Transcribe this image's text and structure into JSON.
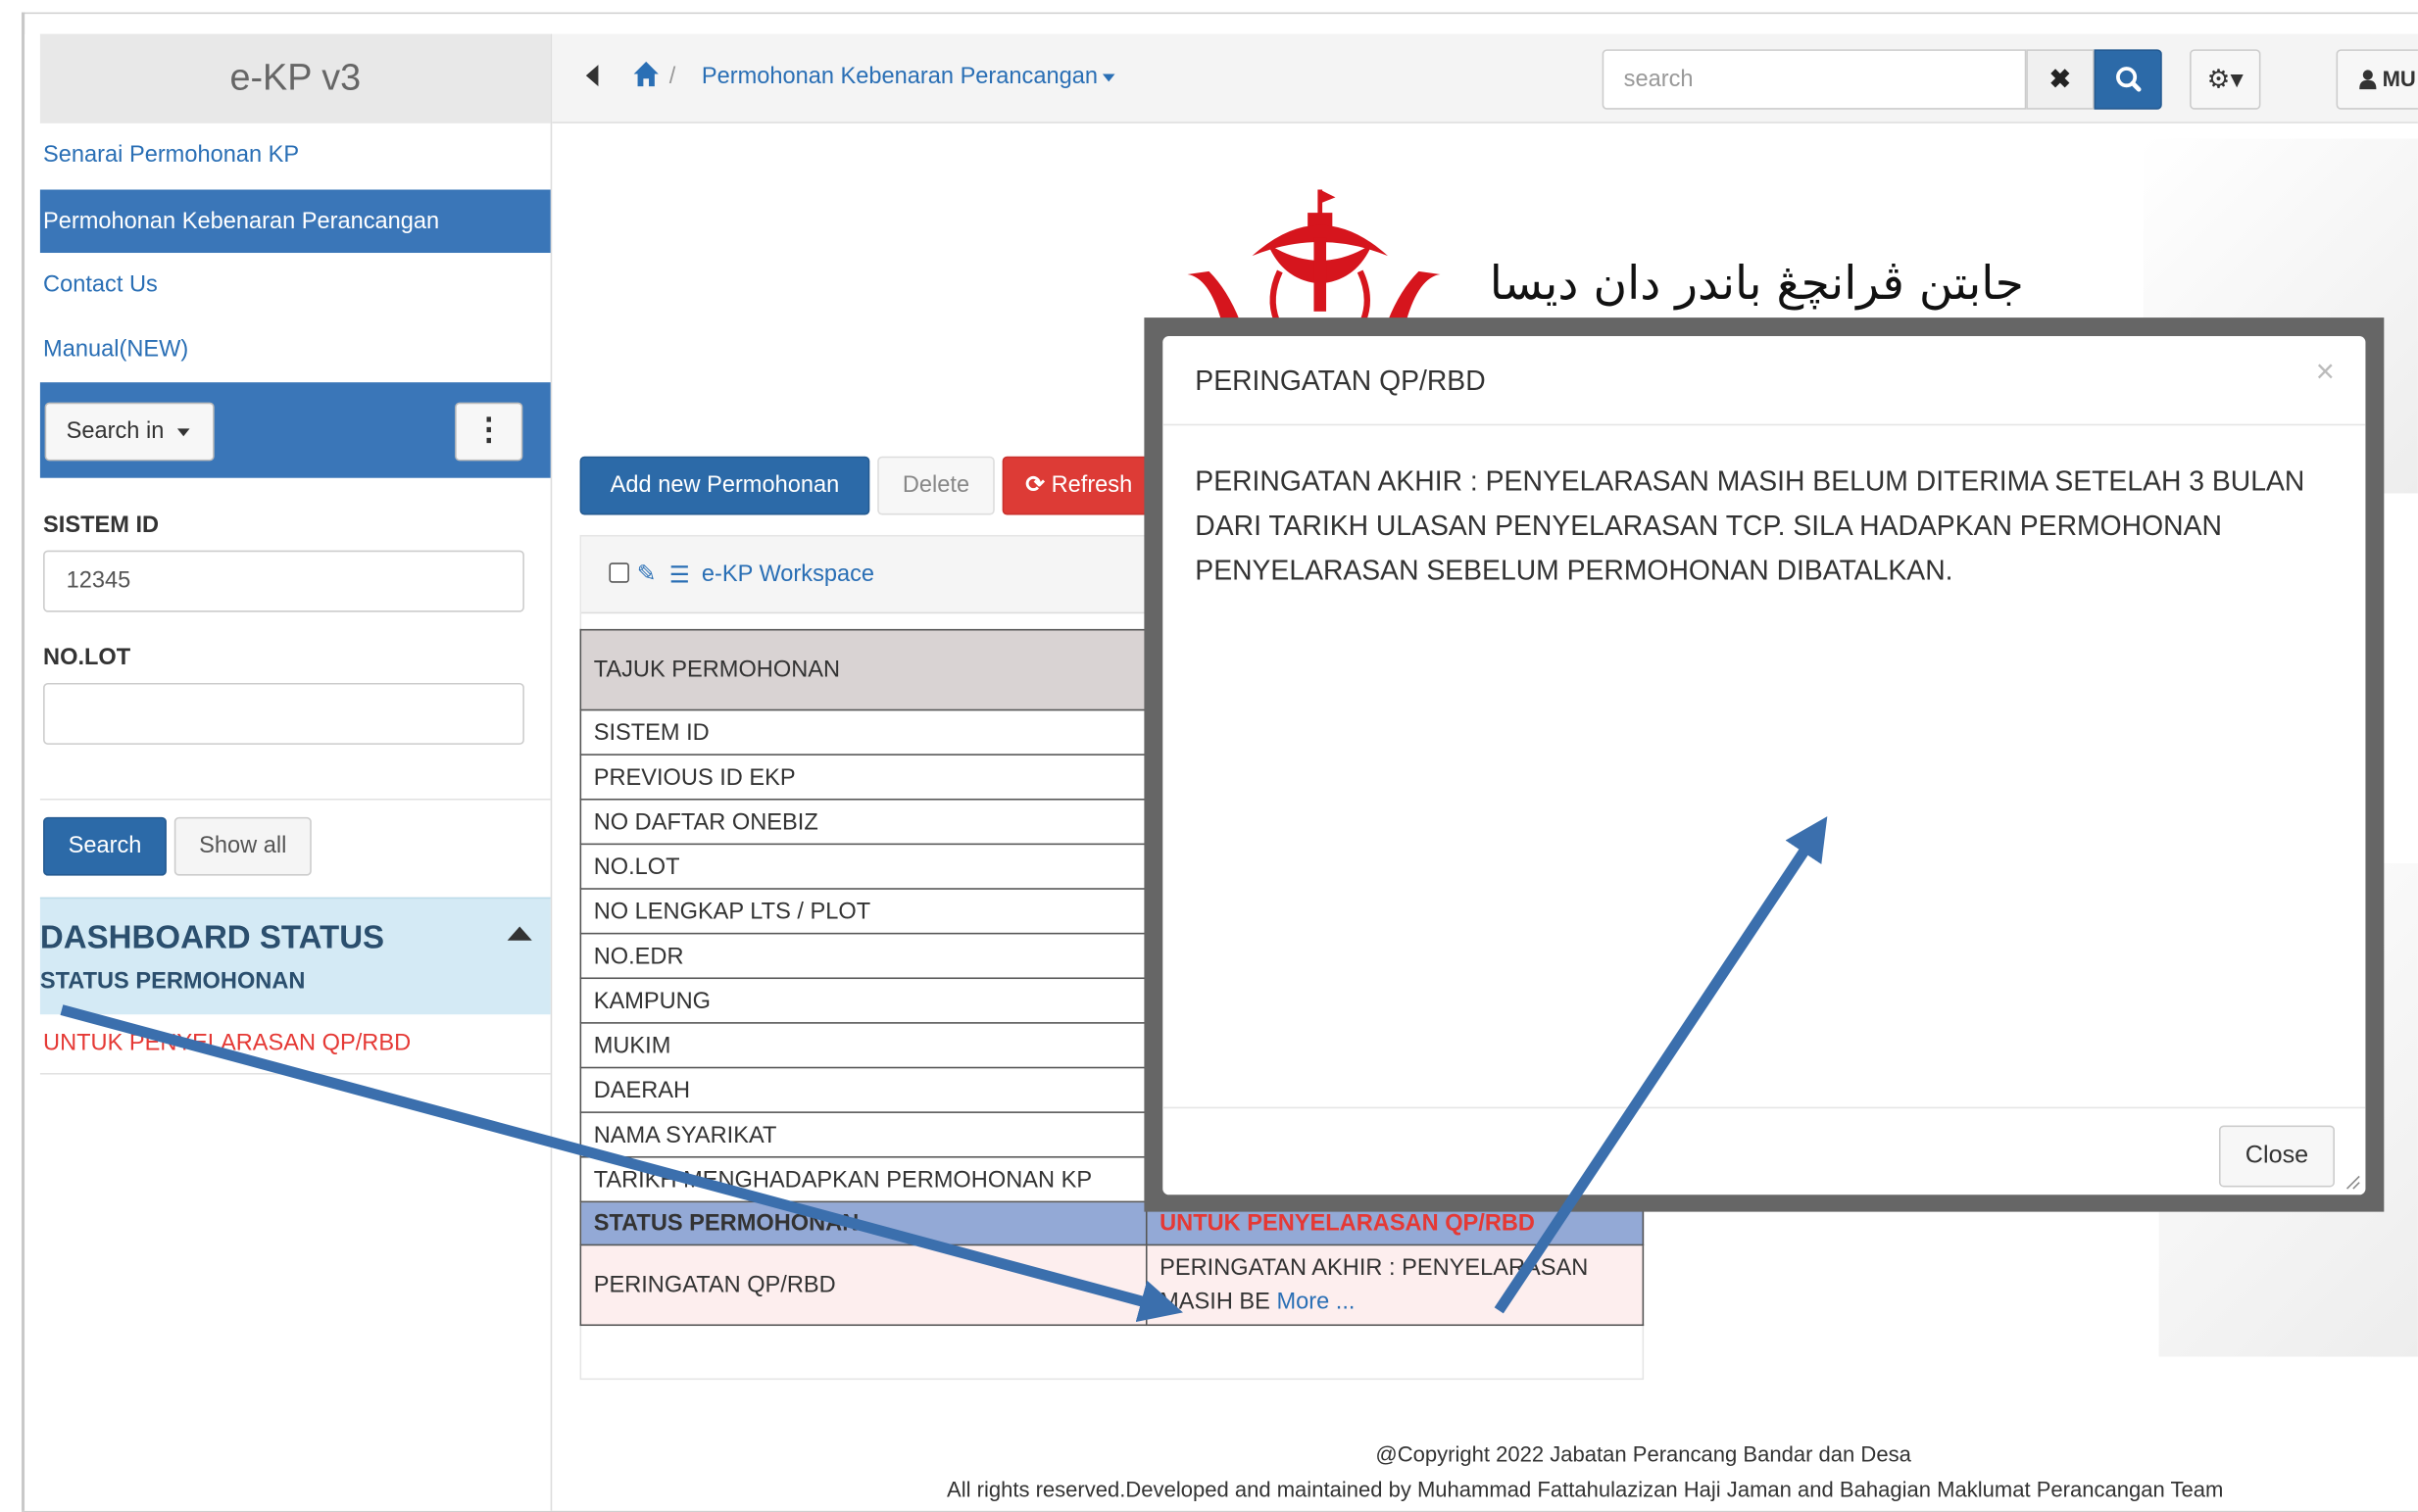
{
  "sidebar": {
    "brand": "e-KP v3",
    "links": [
      "Senarai Permohonan KP",
      "Permohonan Kebenaran Perancangan",
      "Contact Us",
      "Manual(NEW)"
    ],
    "search_in_label": "Search in",
    "kebab_label": "⋮",
    "field1_label": "SISTEM ID",
    "field1_value": "12345",
    "field2_label": "NO.LOT",
    "field2_value": "",
    "search_button": "Search",
    "show_all_button": "Show all",
    "dashboard_title": "DASHBOARD STATUS",
    "dashboard_subtitle": "STATUS PERMOHONAN",
    "dashboard_item": "UNTUK PENYELARASAN QP/RBD"
  },
  "topbar": {
    "breadcrumb_separator": "/",
    "breadcrumb_label": "Permohonan Kebenaran Perancangan",
    "search_placeholder": "search",
    "clear_label": "✖",
    "gear_label": "⚙▾",
    "user_label": "MU"
  },
  "banner": {
    "jawi_text": "جابتن ڤرانچڠ باندر دان ديسا"
  },
  "toolbar": {
    "add_label": "Add new Permohonan",
    "delete_label": "Delete",
    "refresh_label": "Refresh"
  },
  "workspace": {
    "label": "e-KP Workspace"
  },
  "table": {
    "header": "TAJUK PERMOHONAN",
    "rows": [
      "SISTEM ID",
      "PREVIOUS ID EKP",
      "NO DAFTAR ONEBIZ",
      "NO.LOT",
      "NO LENGKAP LTS / PLOT",
      "NO.EDR",
      "KAMPUNG",
      "MUKIM",
      "DAERAH",
      "NAMA SYARIKAT",
      "TARIKH MENGHADAPKAN PERMOHONAN KP"
    ],
    "status_label": "STATUS PERMOHONAN",
    "status_value": "UNTUK PENYELARASAN QP/RBD",
    "warning_label": "PERINGATAN QP/RBD",
    "warning_value": "PERINGATAN AKHIR : PENYELARASAN MASIH BE",
    "more_link": "More ..."
  },
  "footer": {
    "copyright": "@Copyright 2022 Jabatan Perancang Bandar dan Desa",
    "rights": "All rights reserved.Developed and maintained by Muhammad Fattahulazizan Haji Jaman and Bahagian Maklumat Perancangan Team"
  },
  "modal": {
    "title": "PERINGATAN QP/RBD",
    "close_x": "×",
    "body": "PERINGATAN AKHIR : PENYELARASAN MASIH BELUM DITERIMA SETELAH 3 BULAN DARI TARIKH ULASAN PENYELARASAN TCP. SILA HADAPKAN PERMOHONAN PENYELARASAN SEBELUM PERMOHONAN DIBATALKAN.",
    "close_button": "Close"
  },
  "colors": {
    "primary": "#2c6aa8",
    "danger": "#dd3b36",
    "status_red": "#e53935",
    "annotation_arrow": "#3b6fad"
  }
}
